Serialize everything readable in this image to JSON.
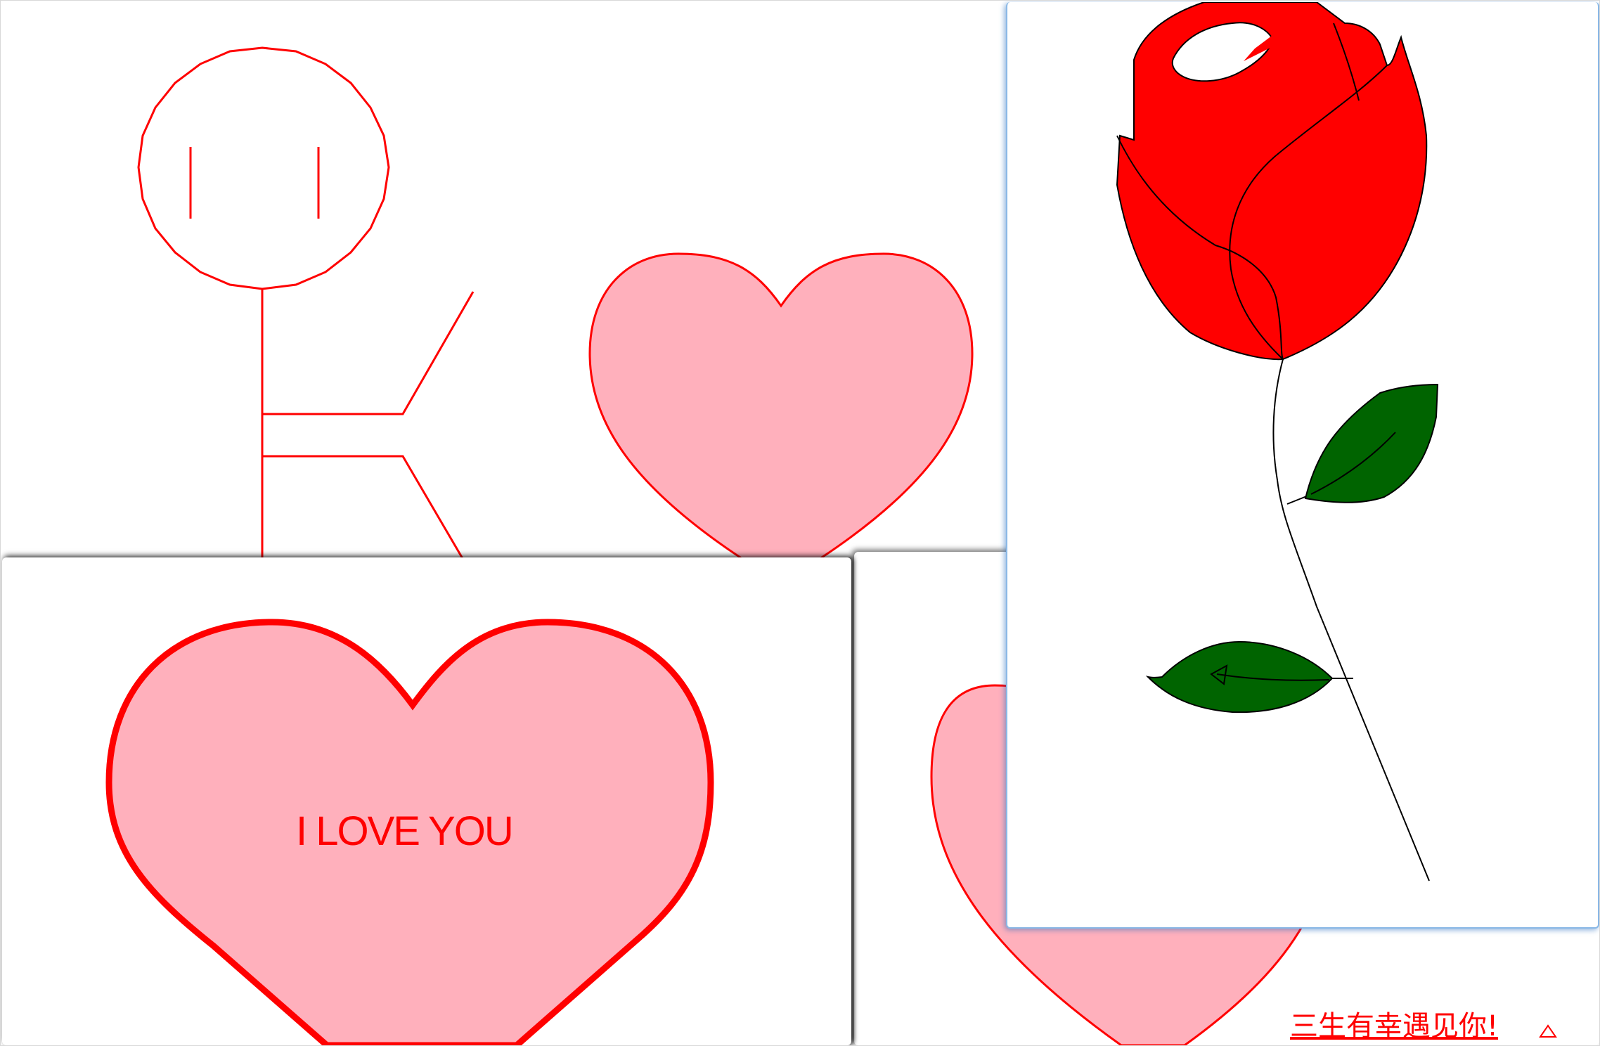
{
  "colors": {
    "line_red": "#ff0000",
    "heart_pink": "#ffb0bc",
    "rose_red": "#ff0000",
    "leaf_green": "#006400",
    "stem_black": "#000000",
    "rose_border_blue": "#8ab8e6"
  },
  "windows": {
    "stickman": {
      "content": "stick figure drawing and pink heart"
    },
    "love_card": {
      "message": "I LOVE YOU"
    },
    "heart_back": {
      "caption": "三生有幸遇见你!"
    },
    "rose": {
      "content": "red rose with green leaves"
    }
  },
  "icons": {
    "caption_mark": "turtle-cursor-icon"
  }
}
